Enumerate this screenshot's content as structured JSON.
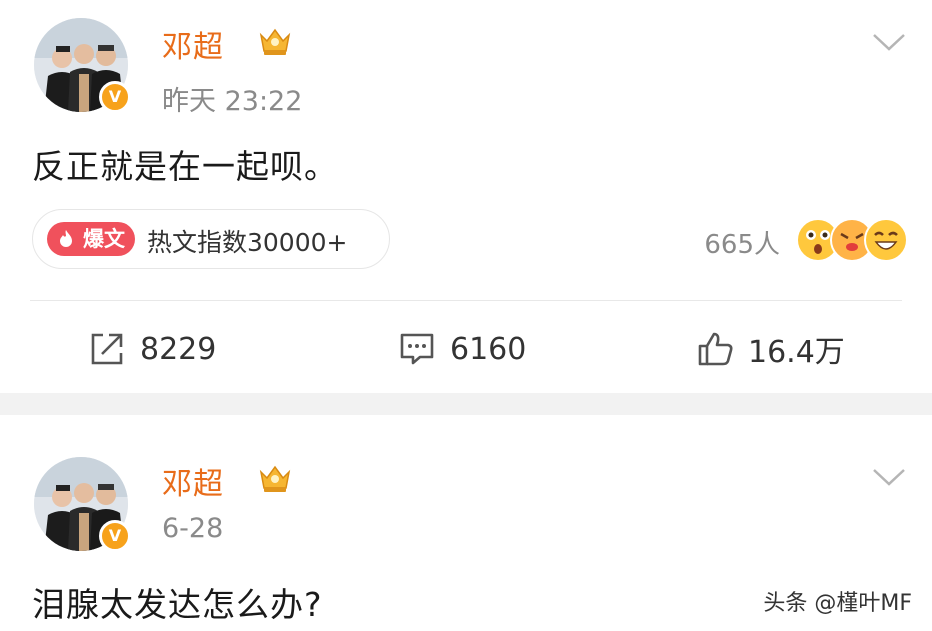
{
  "posts": [
    {
      "username": "邓超",
      "time": "昨天 23:22",
      "content": "反正就是在一起呗。",
      "hot_tag": "爆文",
      "hot_text": "热文指数30000+",
      "reaction_count": "665人",
      "actions": {
        "repost": "8229",
        "comment": "6160",
        "like": "16.4万"
      }
    },
    {
      "username": "邓超",
      "time": "6-28",
      "content": "泪腺太发达怎么办?"
    }
  ],
  "badge_text": "V",
  "watermark": "头条 @槿叶MF",
  "icons": [
    "chevron-down-icon",
    "crown-icon",
    "repost-icon",
    "comment-icon",
    "like-icon",
    "flame-icon"
  ],
  "colors": {
    "username": "#e86c1a",
    "badge": "#f7a21b",
    "hot_tag": "#f0515c",
    "muted": "#8a8a8a",
    "band": "#f2f2f2"
  }
}
